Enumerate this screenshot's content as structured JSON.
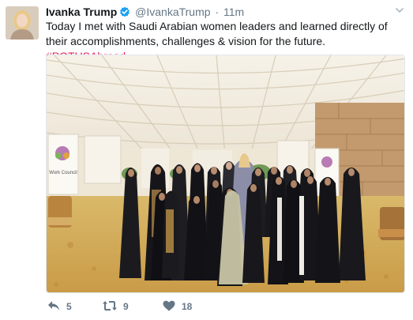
{
  "author": {
    "display_name": "Ivanka Trump",
    "handle": "@IvankaTrump",
    "separator": "·",
    "timestamp": "11m",
    "verified": true,
    "verified_icon": "verified-badge-icon"
  },
  "tweet": {
    "text": "Today I met with Saudi Arabian women leaders and learned directly of their accomplishments, challenges & vision for the future.",
    "hashtag": "#POTUSAbroad",
    "hashtag_color": "#e0245e"
  },
  "photo": {
    "banners": [
      "Work Council",
      "",
      ""
    ]
  },
  "actions": {
    "replies": "5",
    "retweets": "9",
    "likes": "18",
    "icon_color": "#657786"
  },
  "colors": {
    "text": "#14171a",
    "muted": "#657786",
    "verified_blue": "#1da1f2"
  }
}
